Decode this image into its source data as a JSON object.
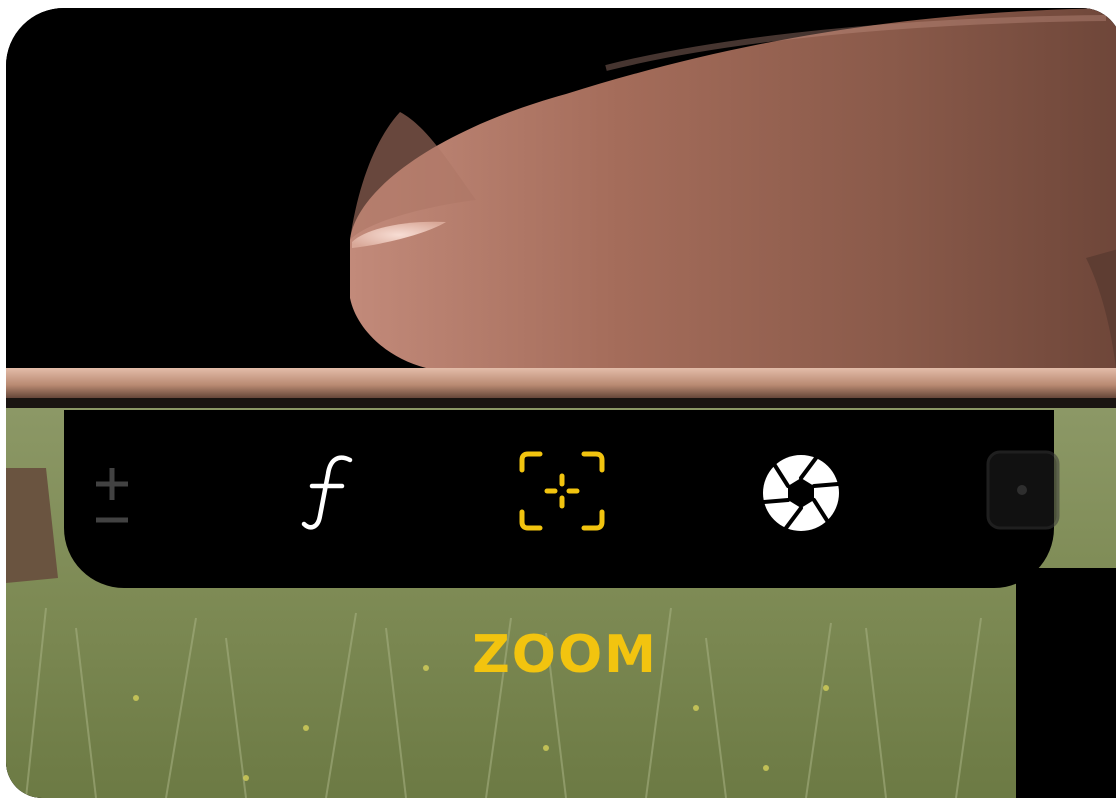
{
  "mode": {
    "label": "ZOOM",
    "active_color": "#f2c40f"
  },
  "controls": [
    {
      "id": "exposure",
      "icon": "plus-minus-icon",
      "state": "faded"
    },
    {
      "id": "aperture",
      "icon": "f-stop-icon",
      "state": "inactive"
    },
    {
      "id": "focus",
      "icon": "focus-frame-icon",
      "state": "active"
    },
    {
      "id": "shutter",
      "icon": "aperture-shutter-icon",
      "state": "inactive"
    },
    {
      "id": "next",
      "icon": "square-icon",
      "state": "faded"
    }
  ],
  "colors": {
    "bar": "#000000",
    "icon": "#ffffff",
    "active": "#f2c40f"
  }
}
